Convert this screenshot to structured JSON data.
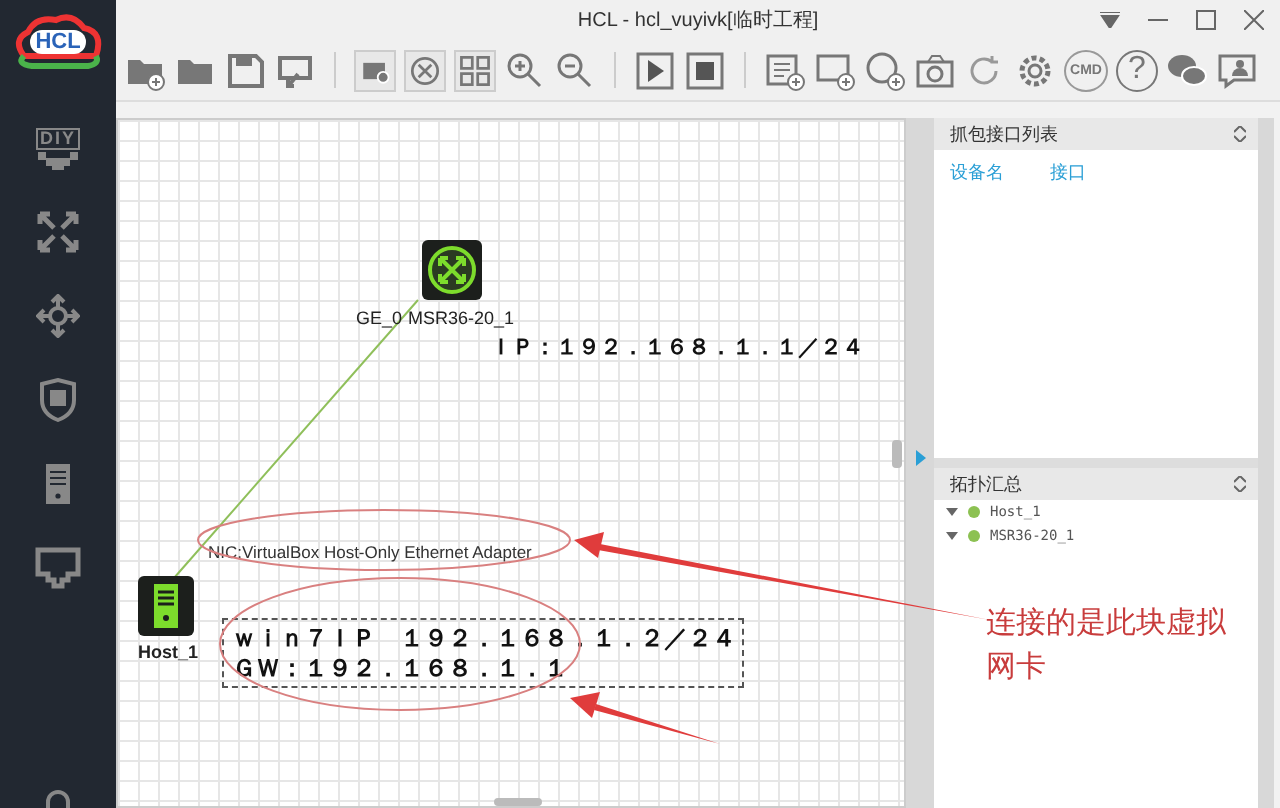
{
  "app": {
    "logo": "HCL",
    "title": "HCL - hcl_vuyivk[临时工程]"
  },
  "toolbar": {
    "cmd_label": "CMD",
    "help_label": "?"
  },
  "sidebar": {
    "diy_label": "DIY"
  },
  "canvas": {
    "devices": [
      {
        "kind": "router",
        "name": "MSR36-20_1",
        "port": "GE_0"
      },
      {
        "kind": "host",
        "name": "Host_1"
      }
    ],
    "ip_note": "ＩＰ：１９２．１６８．１．１／２４",
    "nic_label": "NIC:VirtualBox Host-Only Ethernet Adapter",
    "host_note": [
      "ｗｉｎ７ＩＰ　１９２．１６８．１．２／２４",
      "ＧＷ：１９２．１６８．１．１"
    ],
    "callout": "连接的是此块虚拟网卡"
  },
  "capture_panel": {
    "title": "抓包接口列表",
    "columns": [
      "设备名",
      "接口"
    ]
  },
  "topology_panel": {
    "title": "拓扑汇总",
    "items": [
      {
        "label": "Host_1"
      },
      {
        "label": "MSR36-20_1"
      }
    ]
  }
}
